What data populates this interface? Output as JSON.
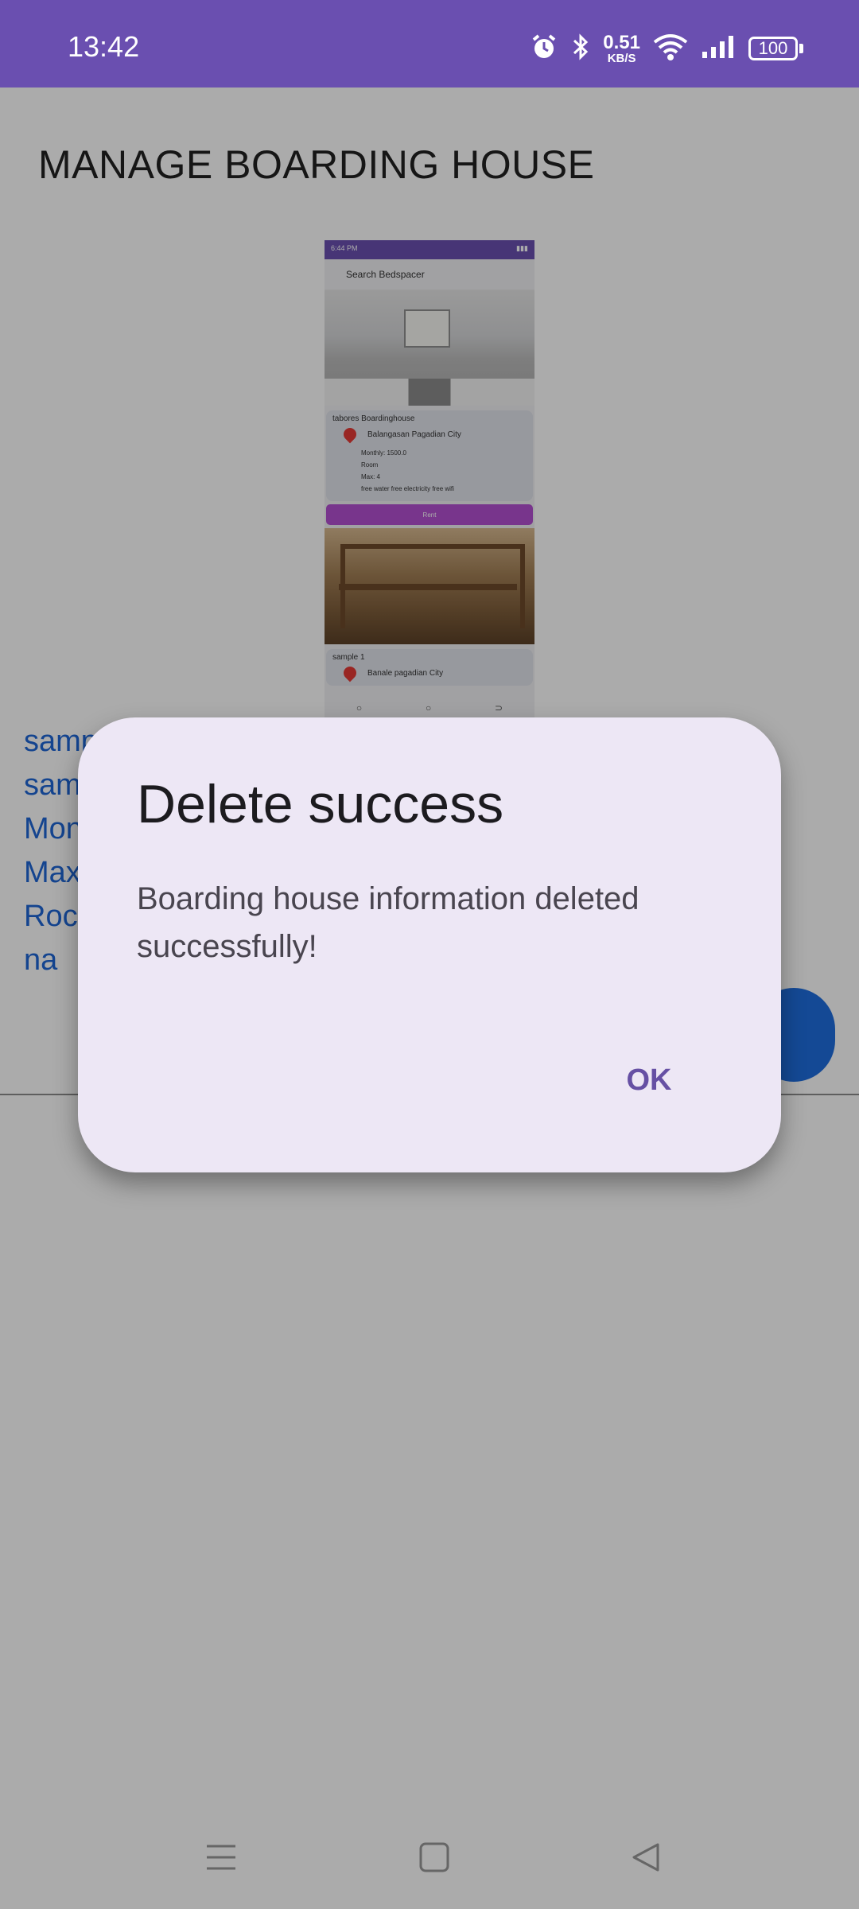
{
  "status_bar": {
    "time": "13:42",
    "network_speed_value": "0.51",
    "network_speed_unit": "KB/S",
    "battery": "100",
    "icons": [
      "alarm-icon",
      "bluetooth-icon",
      "wifi-icon",
      "signal-icon",
      "battery-icon"
    ]
  },
  "page": {
    "title": "MANAGE BOARDING HOUSE"
  },
  "preview": {
    "status_time": "6:44 PM",
    "search_label": "Search Bedspacer",
    "cards": [
      {
        "name": "tabores Boardinghouse",
        "address": "Balangasan Pagadian City",
        "monthly": "Monthly: 1500.0",
        "room": "Room",
        "max": "Max: 4",
        "amenities": "free water free electricity free wifi"
      },
      {
        "name": "sample 1",
        "address": "Banale pagadian City"
      }
    ],
    "rent_label": "Rent"
  },
  "boarding_list": [
    "samp",
    "sam",
    "Mon",
    "Max",
    "Roc",
    "na"
  ],
  "dialog": {
    "title": "Delete success",
    "message": "Boarding house information deleted successfully!",
    "ok_label": "OK"
  },
  "colors": {
    "status_bar": "#6a4fb0",
    "dialog_bg": "#ede7f5",
    "accent": "#6650a4",
    "link_blue": "#1e66d6"
  }
}
